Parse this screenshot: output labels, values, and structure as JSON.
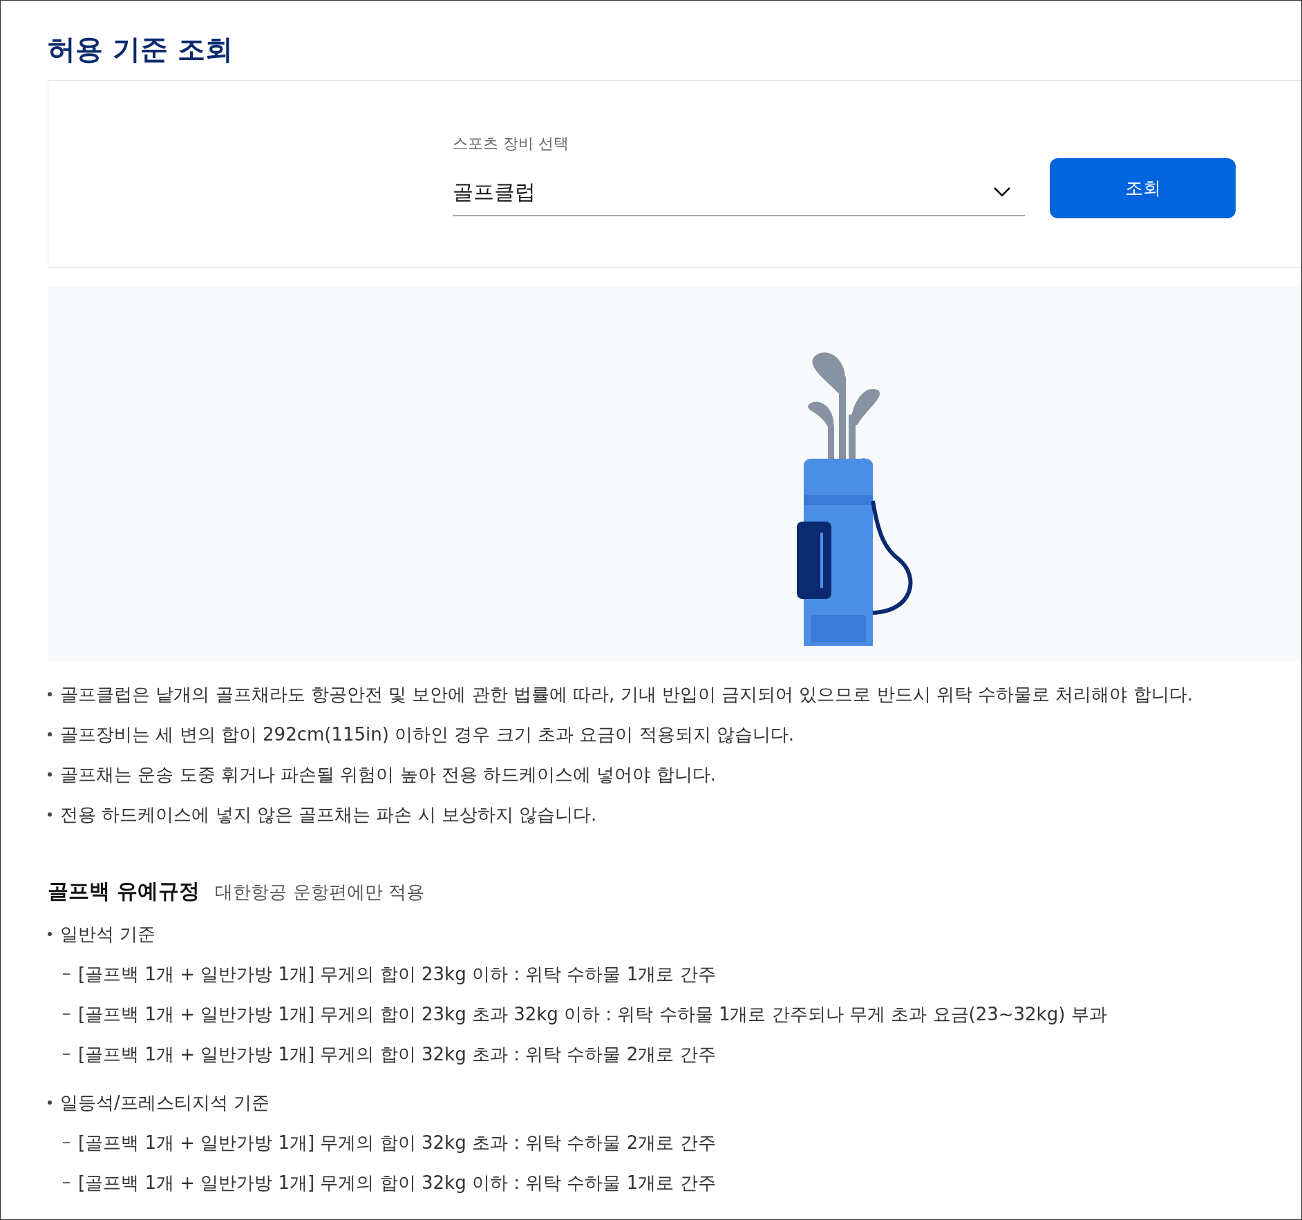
{
  "title": "허용 기준 조회",
  "search_form": {
    "label": "스포츠 장비 선택",
    "value": "골프클럽",
    "button": "조회"
  },
  "notes": [
    "골프클럽은 낱개의 골프채라도 항공안전 및 보안에 관한 법률에 따라, 기내 반입이 금지되어 있으므로 반드시 위탁 수하물로 처리해야 합니다.",
    "골프장비는 세 변의 합이 292cm(115in) 이하인 경우 크기 초과 요금이 적용되지 않습니다.",
    "골프채는 운송 도중 휘거나 파손될 위험이 높아 전용 하드케이스에 넣어야 합니다.",
    "전용 하드케이스에 넣지 않은 골프채는 파손 시 보상하지 않습니다."
  ],
  "section": {
    "title": "골프백 유예규정",
    "subtitle": "대한항공 운항편에만 적용",
    "groups": [
      {
        "label": "일반석 기준",
        "items": [
          "[골프백 1개 + 일반가방 1개] 무게의 합이 23kg 이하 : 위탁 수하물 1개로 간주",
          "[골프백 1개 + 일반가방 1개] 무게의 합이 23kg 초과 32kg 이하 : 위탁 수하물 1개로 간주되나 무게 초과 요금(23~32kg) 부과",
          "[골프백 1개 + 일반가방 1개] 무게의 합이 32kg 초과 : 위탁 수하물 2개로 간주"
        ]
      },
      {
        "label": "일등석/프레스티지석 기준",
        "items": [
          "[골프백 1개 + 일반가방 1개] 무게의 합이 32kg 초과 : 위탁 수하물 2개로 간주",
          "[골프백 1개 + 일반가방 1개] 무게의 합이 32kg 이하 : 위탁 수하물 1개로 간주"
        ]
      }
    ]
  }
}
